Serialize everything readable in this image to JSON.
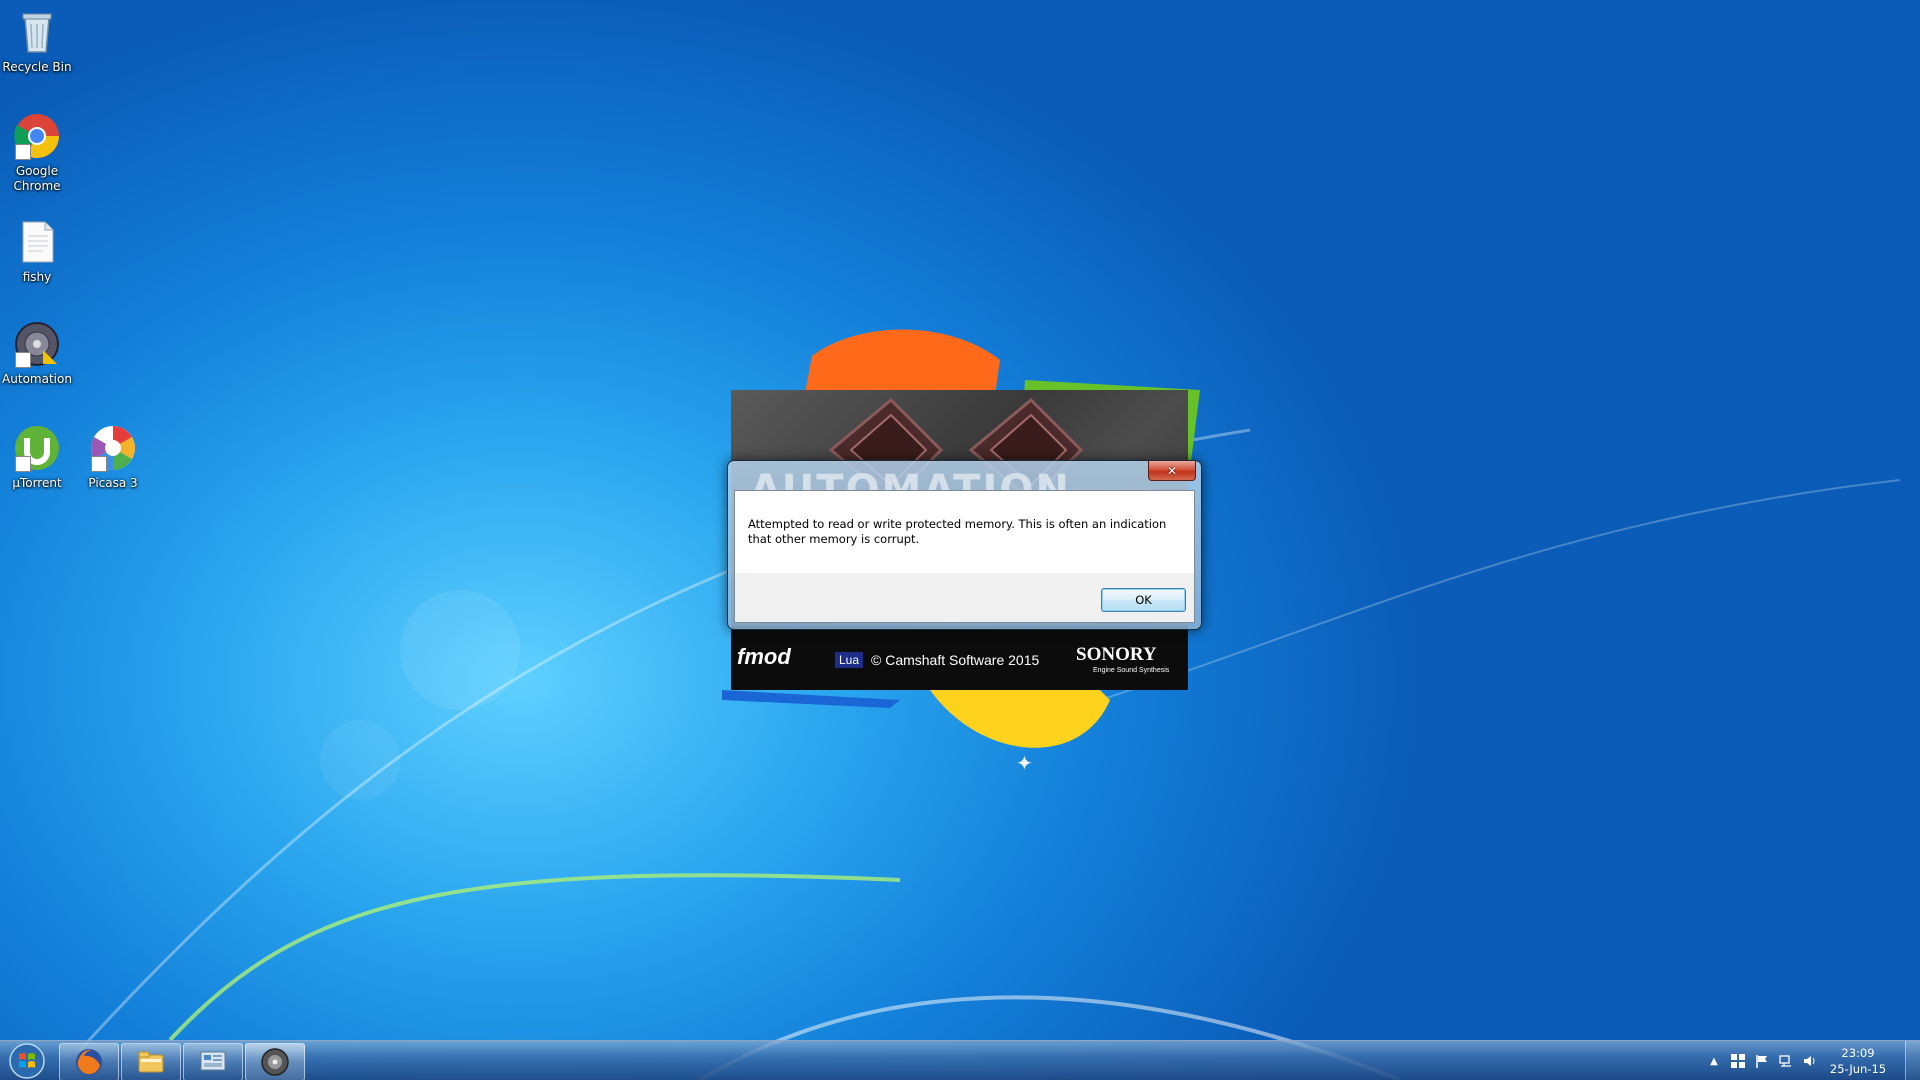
{
  "desktop": {
    "icons": [
      {
        "label": "Recycle Bin",
        "icon": "recycle-bin-icon"
      },
      {
        "label": "Google Chrome",
        "icon": "chrome-icon"
      },
      {
        "label": "fishy",
        "icon": "text-document-icon"
      },
      {
        "label": "Automation",
        "icon": "automation-app-icon"
      },
      {
        "label": "µTorrent",
        "icon": "utorrent-icon"
      },
      {
        "label": "Picasa 3",
        "icon": "picasa-icon"
      }
    ]
  },
  "splash": {
    "ghost_title": "AUTOMATION",
    "fmod_logo": "fmod",
    "lua_logo": "Lua",
    "copyright": "© Camshaft Software 2015",
    "sonory_logo": "SONORY",
    "sonory_tagline": "Engine Sound Synthesis"
  },
  "dialog": {
    "close_glyph": "✕",
    "message": "Attempted to read or write protected memory. This is often an indication that other memory is corrupt.",
    "ok_label": "OK"
  },
  "taskbar": {
    "pinned": [
      {
        "icon": "firefox-icon"
      },
      {
        "icon": "windows-explorer-icon"
      },
      {
        "icon": "control-panel-icon"
      },
      {
        "icon": "automation-app-icon",
        "active": true
      }
    ],
    "tray": [
      "show-hidden-icons-icon",
      "windows-icon",
      "action-center-flag-icon",
      "network-icon",
      "volume-icon"
    ],
    "clock": {
      "time": "23:09",
      "date": "25-Jun-15"
    }
  },
  "colors": {
    "desktop_blue": "#137fd9",
    "close_red": "#c1331b",
    "ok_border": "#3c7fb1"
  }
}
